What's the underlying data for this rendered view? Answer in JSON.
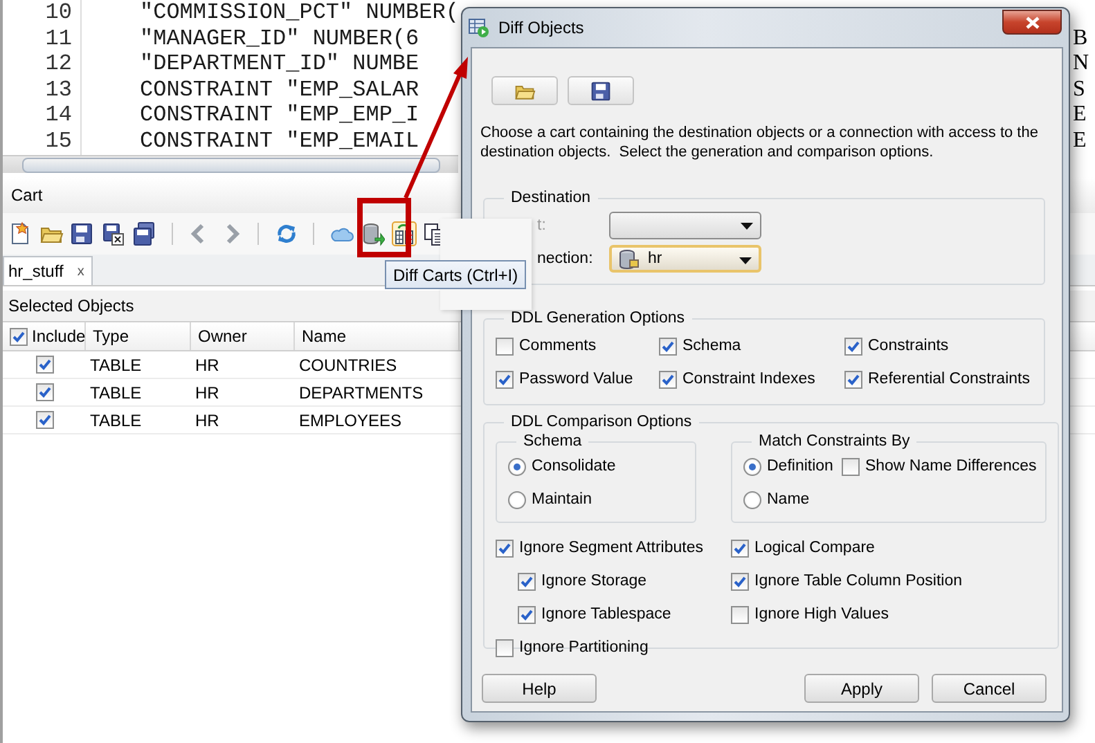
{
  "editor": {
    "lines": [
      {
        "number": "10",
        "code": "\"COMMISSION_PCT\" NUMBER("
      },
      {
        "number": "11",
        "code": "\"MANAGER_ID\" NUMBER(6",
        "right": "B"
      },
      {
        "number": "12",
        "code": "\"DEPARTMENT_ID\" NUMBE",
        "right": "N"
      },
      {
        "number": "13",
        "code": "CONSTRAINT \"EMP_SALAR",
        "right": "S"
      },
      {
        "number": "14",
        "code": "CONSTRAINT \"EMP_EMP_I",
        "right": "E"
      },
      {
        "number": "15",
        "code": "CONSTRAINT \"EMP_EMAIL",
        "right": "E"
      }
    ]
  },
  "cart": {
    "title": "Cart",
    "tabs": [
      {
        "label": "hr_stuff",
        "close": "x",
        "selected": true
      }
    ],
    "section_title": "Selected Objects",
    "table": {
      "columns": [
        "Include",
        "Type",
        "Owner",
        "Name"
      ],
      "all_included": true,
      "rows": [
        {
          "include": true,
          "type": "TABLE",
          "owner": "HR",
          "name": "COUNTRIES"
        },
        {
          "include": true,
          "type": "TABLE",
          "owner": "HR",
          "name": "DEPARTMENTS"
        },
        {
          "include": true,
          "type": "TABLE",
          "owner": "HR",
          "name": "EMPLOYEES"
        }
      ]
    }
  },
  "tooltip": {
    "text": "Diff Carts (Ctrl+I)"
  },
  "dialog": {
    "title": "Diff Objects",
    "description": "Choose a cart containing the destination objects or a connection with access to the destination objects.  Select the generation and comparison options.",
    "destination": {
      "title": "Destination",
      "fields": [
        {
          "label": "t:",
          "disabled": true,
          "focused": false
        },
        {
          "label": "nection:",
          "value": "hr",
          "disabled": false,
          "focused": true
        }
      ]
    },
    "generation": {
      "title": "DDL Generation Options",
      "options": [
        {
          "label": "Comments",
          "checked": false
        },
        {
          "label": "Schema",
          "checked": true
        },
        {
          "label": "Constraints",
          "checked": true
        },
        {
          "label": "Password Value",
          "checked": true
        },
        {
          "label": "Constraint Indexes",
          "checked": true
        },
        {
          "label": "Referential Constraints",
          "checked": true
        }
      ]
    },
    "comparison": {
      "title": "DDL Comparison Options",
      "schema": {
        "title": "Schema",
        "options": [
          {
            "label": "Consolidate",
            "selected": true
          },
          {
            "label": "Maintain",
            "selected": false
          }
        ]
      },
      "match": {
        "title": "Match Constraints By",
        "options": [
          {
            "label": "Definition",
            "selected": true
          },
          {
            "label": "Name",
            "selected": false
          }
        ],
        "show_differences": {
          "label": "Show Name Differences",
          "checked": false
        }
      },
      "left_options": [
        {
          "label": "Ignore Segment Attributes",
          "checked": true,
          "children": [
            {
              "label": "Ignore Storage",
              "checked": true
            },
            {
              "label": "Ignore Tablespace",
              "checked": true
            }
          ]
        },
        {
          "label": "Ignore Partitioning",
          "checked": false
        }
      ],
      "right_options": [
        {
          "label": "Logical Compare",
          "checked": true
        },
        {
          "label": "Ignore Table Column Position",
          "checked": true
        },
        {
          "label": "Ignore High Values",
          "checked": false
        }
      ]
    },
    "buttons": [
      "Help",
      "Apply",
      "Cancel"
    ]
  }
}
